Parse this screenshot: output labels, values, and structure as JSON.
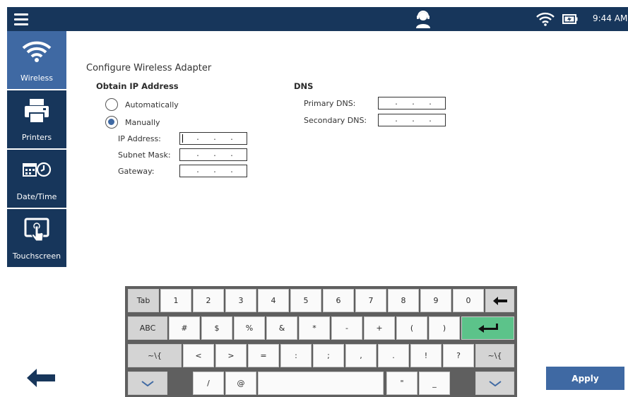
{
  "header": {
    "menu_icon": "hamburger-menu-icon",
    "center_icon": "support-agent-icon",
    "wifi_icon": "wifi-icon",
    "battery_icon": "battery-charging-icon",
    "time": "9:44 AM"
  },
  "sidebar": {
    "items": [
      {
        "label": "Wireless",
        "icon": "wifi-icon",
        "active": true
      },
      {
        "label": "Printers",
        "icon": "printer-icon",
        "active": false
      },
      {
        "label": "Date/Time",
        "icon": "calendar-clock-icon",
        "active": false
      },
      {
        "label": "Touchscreen",
        "icon": "touchscreen-icon",
        "active": false
      }
    ]
  },
  "main": {
    "title": "Configure Wireless Adapter",
    "obtain_heading": "Obtain IP Address",
    "radio_auto": "Automatically",
    "radio_manual": "Manually",
    "selected_mode": "Manually",
    "ip_label": "IP Address:",
    "subnet_label": "Subnet Mask:",
    "gateway_label": "Gateway:",
    "dns_heading": "DNS",
    "primary_dns_label": "Primary DNS:",
    "secondary_dns_label": "Secondary DNS:",
    "ip_dot": "."
  },
  "keyboard": {
    "row1": [
      "Tab",
      "1",
      "2",
      "3",
      "4",
      "5",
      "6",
      "7",
      "8",
      "9",
      "0"
    ],
    "row2": [
      "ABC",
      "#",
      "$",
      "%",
      "&",
      "*",
      "-",
      "+",
      "(",
      ")"
    ],
    "row3": [
      "~\\{",
      "<",
      ">",
      "=",
      ":",
      ";",
      ",",
      ".",
      "!",
      "?",
      "~\\{"
    ],
    "row4": [
      "/",
      "@",
      "\"",
      "_"
    ],
    "backspace_icon": "backspace-arrow-icon",
    "enter_icon": "enter-return-icon",
    "chevron_icon": "chevron-down-icon"
  },
  "footer": {
    "back_icon": "back-arrow-icon",
    "apply_label": "Apply"
  },
  "colors": {
    "navy": "#17365b",
    "accent": "#3f69a3",
    "green": "#5cc38a"
  }
}
